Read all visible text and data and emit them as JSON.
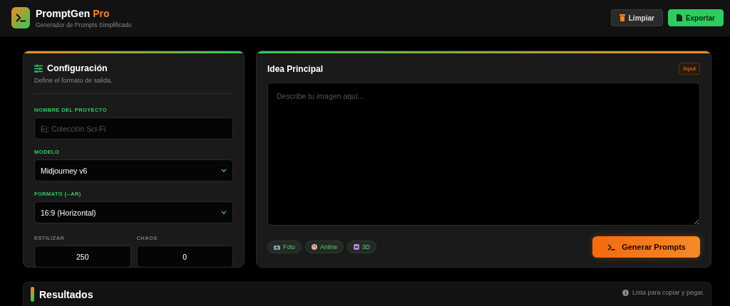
{
  "header": {
    "title": "PromptGen",
    "title_accent": "Pro",
    "subtitle": "Generador de Prompts Simplificado",
    "buttons": [
      {
        "label": "Limpiar",
        "kind": "secondary"
      },
      {
        "label": "Exportar",
        "kind": "primary"
      }
    ]
  },
  "config": {
    "title": "Configuración",
    "subtitle": "Define el formato de salida.",
    "fields": [
      {
        "kind": "text",
        "label": "NOMBRE DEL PROYECTO",
        "placeholder": "Ej: Colección Sci-Fi"
      },
      {
        "kind": "select",
        "label": "MODELO",
        "value": "Midjourney v6"
      },
      {
        "kind": "select",
        "label": "FORMATO (--AR)",
        "value": "16:9 (Horizontal)"
      }
    ],
    "numbers": [
      {
        "label": "ESTILIZAR",
        "value": "250"
      },
      {
        "label": "CHAOS",
        "value": "0"
      }
    ]
  },
  "idea": {
    "title": "Idea Principal",
    "badge": "Input",
    "placeholder": "Describe tu imagen aquí...",
    "chips": [
      {
        "label": "Foto",
        "kind": "camera"
      },
      {
        "label": "Anime",
        "kind": "palette"
      },
      {
        "label": "3D",
        "kind": "cube"
      }
    ],
    "button": "Generar Prompts"
  },
  "results": {
    "title": "Resultados",
    "hint": "Lista para copiar y pegar."
  }
}
